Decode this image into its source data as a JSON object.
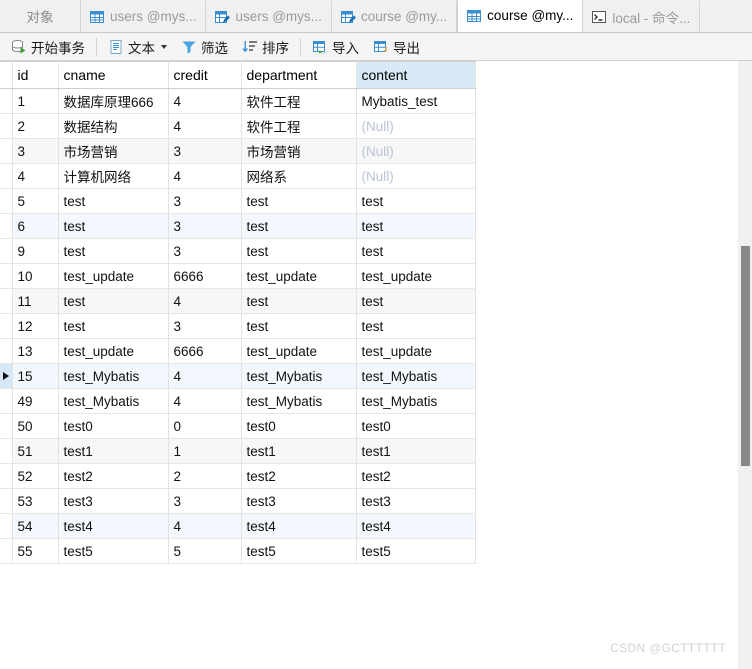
{
  "tabbar": {
    "objects_label": "对象",
    "tabs": [
      {
        "label": "users @mys...",
        "icon": "table-grid-icon",
        "active": false
      },
      {
        "label": "users @mys...",
        "icon": "table-design-icon",
        "active": false
      },
      {
        "label": "course @my...",
        "icon": "table-design-icon",
        "active": false
      },
      {
        "label": "course @my...",
        "icon": "table-grid-icon",
        "active": true
      },
      {
        "label": "local - 命令...",
        "icon": "console-icon",
        "active": false
      }
    ]
  },
  "toolbar": {
    "buttons": [
      {
        "label": "开始事务",
        "icon": "begin-transaction-icon",
        "caret": false
      },
      {
        "label": "文本",
        "icon": "text-icon",
        "caret": true
      },
      {
        "label": "筛选",
        "icon": "filter-icon",
        "caret": false
      },
      {
        "label": "排序",
        "icon": "sort-icon",
        "caret": false
      },
      {
        "label": "导入",
        "icon": "import-icon",
        "caret": false
      },
      {
        "label": "导出",
        "icon": "export-icon",
        "caret": false
      }
    ]
  },
  "grid": {
    "columns": [
      {
        "key": "id",
        "label": "id",
        "align": "right",
        "selected": false
      },
      {
        "key": "cname",
        "label": "cname",
        "align": "left",
        "selected": false
      },
      {
        "key": "credit",
        "label": "credit",
        "align": "right",
        "selected": false
      },
      {
        "key": "department",
        "label": "department",
        "align": "left",
        "selected": false
      },
      {
        "key": "content",
        "label": "content",
        "align": "left",
        "selected": true
      }
    ],
    "null_text": "(Null)",
    "current_row_index": 11,
    "rows": [
      {
        "id": "1",
        "cname": "数据库原理666",
        "credit": "4",
        "department": "软件工程",
        "content": "Mybatis_test",
        "stripe": "none"
      },
      {
        "id": "2",
        "cname": "数据结构",
        "credit": "4",
        "department": "软件工程",
        "content": null,
        "stripe": "none"
      },
      {
        "id": "3",
        "cname": "市场营销",
        "credit": "3",
        "department": "市场营销",
        "content": null,
        "stripe": "grey"
      },
      {
        "id": "4",
        "cname": "计算机网络",
        "credit": "4",
        "department": "网络系",
        "content": null,
        "stripe": "none"
      },
      {
        "id": "5",
        "cname": "test",
        "credit": "3",
        "department": "test",
        "content": "test",
        "stripe": "none"
      },
      {
        "id": "6",
        "cname": "test",
        "credit": "3",
        "department": "test",
        "content": "test",
        "stripe": "blue"
      },
      {
        "id": "9",
        "cname": "test",
        "credit": "3",
        "department": "test",
        "content": "test",
        "stripe": "none"
      },
      {
        "id": "10",
        "cname": "test_update",
        "credit": "6666",
        "department": "test_update",
        "content": "test_update",
        "stripe": "none"
      },
      {
        "id": "11",
        "cname": "test",
        "credit": "4",
        "department": "test",
        "content": "test",
        "stripe": "grey"
      },
      {
        "id": "12",
        "cname": "test",
        "credit": "3",
        "department": "test",
        "content": "test",
        "stripe": "none"
      },
      {
        "id": "13",
        "cname": "test_update",
        "credit": "6666",
        "department": "test_update",
        "content": "test_update",
        "stripe": "none"
      },
      {
        "id": "15",
        "cname": "test_Mybatis",
        "credit": "4",
        "department": "test_Mybatis",
        "content": "test_Mybatis",
        "stripe": "blue"
      },
      {
        "id": "49",
        "cname": "test_Mybatis",
        "credit": "4",
        "department": "test_Mybatis",
        "content": "test_Mybatis",
        "stripe": "none"
      },
      {
        "id": "50",
        "cname": "test0",
        "credit": "0",
        "department": "test0",
        "content": "test0",
        "stripe": "none"
      },
      {
        "id": "51",
        "cname": "test1",
        "credit": "1",
        "department": "test1",
        "content": "test1",
        "stripe": "grey"
      },
      {
        "id": "52",
        "cname": "test2",
        "credit": "2",
        "department": "test2",
        "content": "test2",
        "stripe": "none"
      },
      {
        "id": "53",
        "cname": "test3",
        "credit": "3",
        "department": "test3",
        "content": "test3",
        "stripe": "none"
      },
      {
        "id": "54",
        "cname": "test4",
        "credit": "4",
        "department": "test4",
        "content": "test4",
        "stripe": "blue"
      },
      {
        "id": "55",
        "cname": "test5",
        "credit": "5",
        "department": "test5",
        "content": "test5",
        "stripe": "none"
      }
    ]
  },
  "watermark": {
    "text": "CSDN @GCTTTTTT"
  },
  "colors": {
    "selected_header": "#d9eaf7",
    "current_row_gutter": "#d6e8f7",
    "stripe_grey": "#f7f7f7",
    "stripe_blue": "#f2f8fd",
    "null_text": "#b9c4d6",
    "accent_blue": "#2f8fd0"
  }
}
